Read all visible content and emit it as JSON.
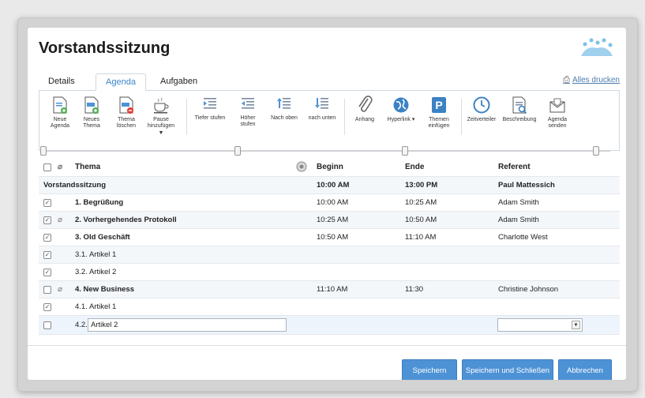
{
  "dialog": {
    "title": "Vorstandssitzung",
    "print_label": "Alles drucken"
  },
  "tabs": [
    {
      "label": "Details"
    },
    {
      "label": "Agenda"
    },
    {
      "label": "Aufgaben"
    }
  ],
  "toolbar": [
    {
      "label": "Neue Agenda",
      "icon": "new-agenda-icon"
    },
    {
      "label": "Neues Thema",
      "icon": "new-topic-icon"
    },
    {
      "label": "Thema löschen",
      "icon": "delete-topic-icon"
    },
    {
      "label": "Pause hinzufügen",
      "icon": "coffee-cup-icon"
    },
    {
      "label": "Tiefer stufen",
      "icon": "indent-icon"
    },
    {
      "label": "Höher stufen",
      "icon": "outdent-icon"
    },
    {
      "label": "Nach oben",
      "icon": "move-up-icon"
    },
    {
      "label": "nach unten",
      "icon": "move-down-icon"
    },
    {
      "label": "Anhang",
      "icon": "paperclip-icon"
    },
    {
      "label": "Hyperlink",
      "icon": "globe-icon"
    },
    {
      "label": "Themen einfügen",
      "icon": "parking-p-icon"
    },
    {
      "label": "Zeitverteiler",
      "icon": "clock-icon"
    },
    {
      "label": "Beschreibung",
      "icon": "description-icon"
    },
    {
      "label": "Agenda senden",
      "icon": "envelope-icon"
    }
  ],
  "table": {
    "headers": {
      "topic": "Thema",
      "start": "Beginn",
      "end": "Ende",
      "speaker": "Referent"
    },
    "group_row": {
      "topic": "Vorstandssitzung",
      "start": "10:00 AM",
      "end": "13:00 PM",
      "speaker": "Paul Mattessich"
    },
    "rows": [
      {
        "checked": true,
        "attach": false,
        "topic": "1. Begrüßung",
        "bold": true,
        "start": "10:00 AM",
        "end": "10:25 AM",
        "speaker": "Adam Smith"
      },
      {
        "checked": true,
        "attach": true,
        "topic": "2. Vorhergehendes Protokoll",
        "bold": true,
        "start": "10:25 AM",
        "end": "10:50 AM",
        "speaker": "Adam Smith"
      },
      {
        "checked": true,
        "attach": false,
        "topic": "3. Old Geschäft",
        "bold": true,
        "start": "10:50 AM",
        "end": "11:10 AM",
        "speaker": "Charlotte West"
      },
      {
        "checked": true,
        "attach": false,
        "topic": "3.1. Artikel 1",
        "bold": false,
        "start": "",
        "end": "",
        "speaker": ""
      },
      {
        "checked": true,
        "attach": false,
        "topic": "3.2. Artikel 2",
        "bold": false,
        "start": "",
        "end": "",
        "speaker": ""
      },
      {
        "checked": false,
        "attach": true,
        "topic": "4. New Business",
        "bold": true,
        "start": "11:10 AM",
        "end": "11:30",
        "speaker": "Christine Johnson"
      },
      {
        "checked": true,
        "attach": false,
        "topic": "4.1. Artikel 1",
        "bold": false,
        "start": "",
        "end": "",
        "speaker": ""
      }
    ],
    "edit_row": {
      "checked": false,
      "number": "4.2.",
      "value": "Artikel 2",
      "speaker_value": ""
    }
  },
  "buttons": {
    "save": "Speichern",
    "save_close": "Speichern und Schließen",
    "cancel": "Abbrechen"
  },
  "colors": {
    "accent": "#4e92d6",
    "tab_active": "#3a86c8"
  }
}
